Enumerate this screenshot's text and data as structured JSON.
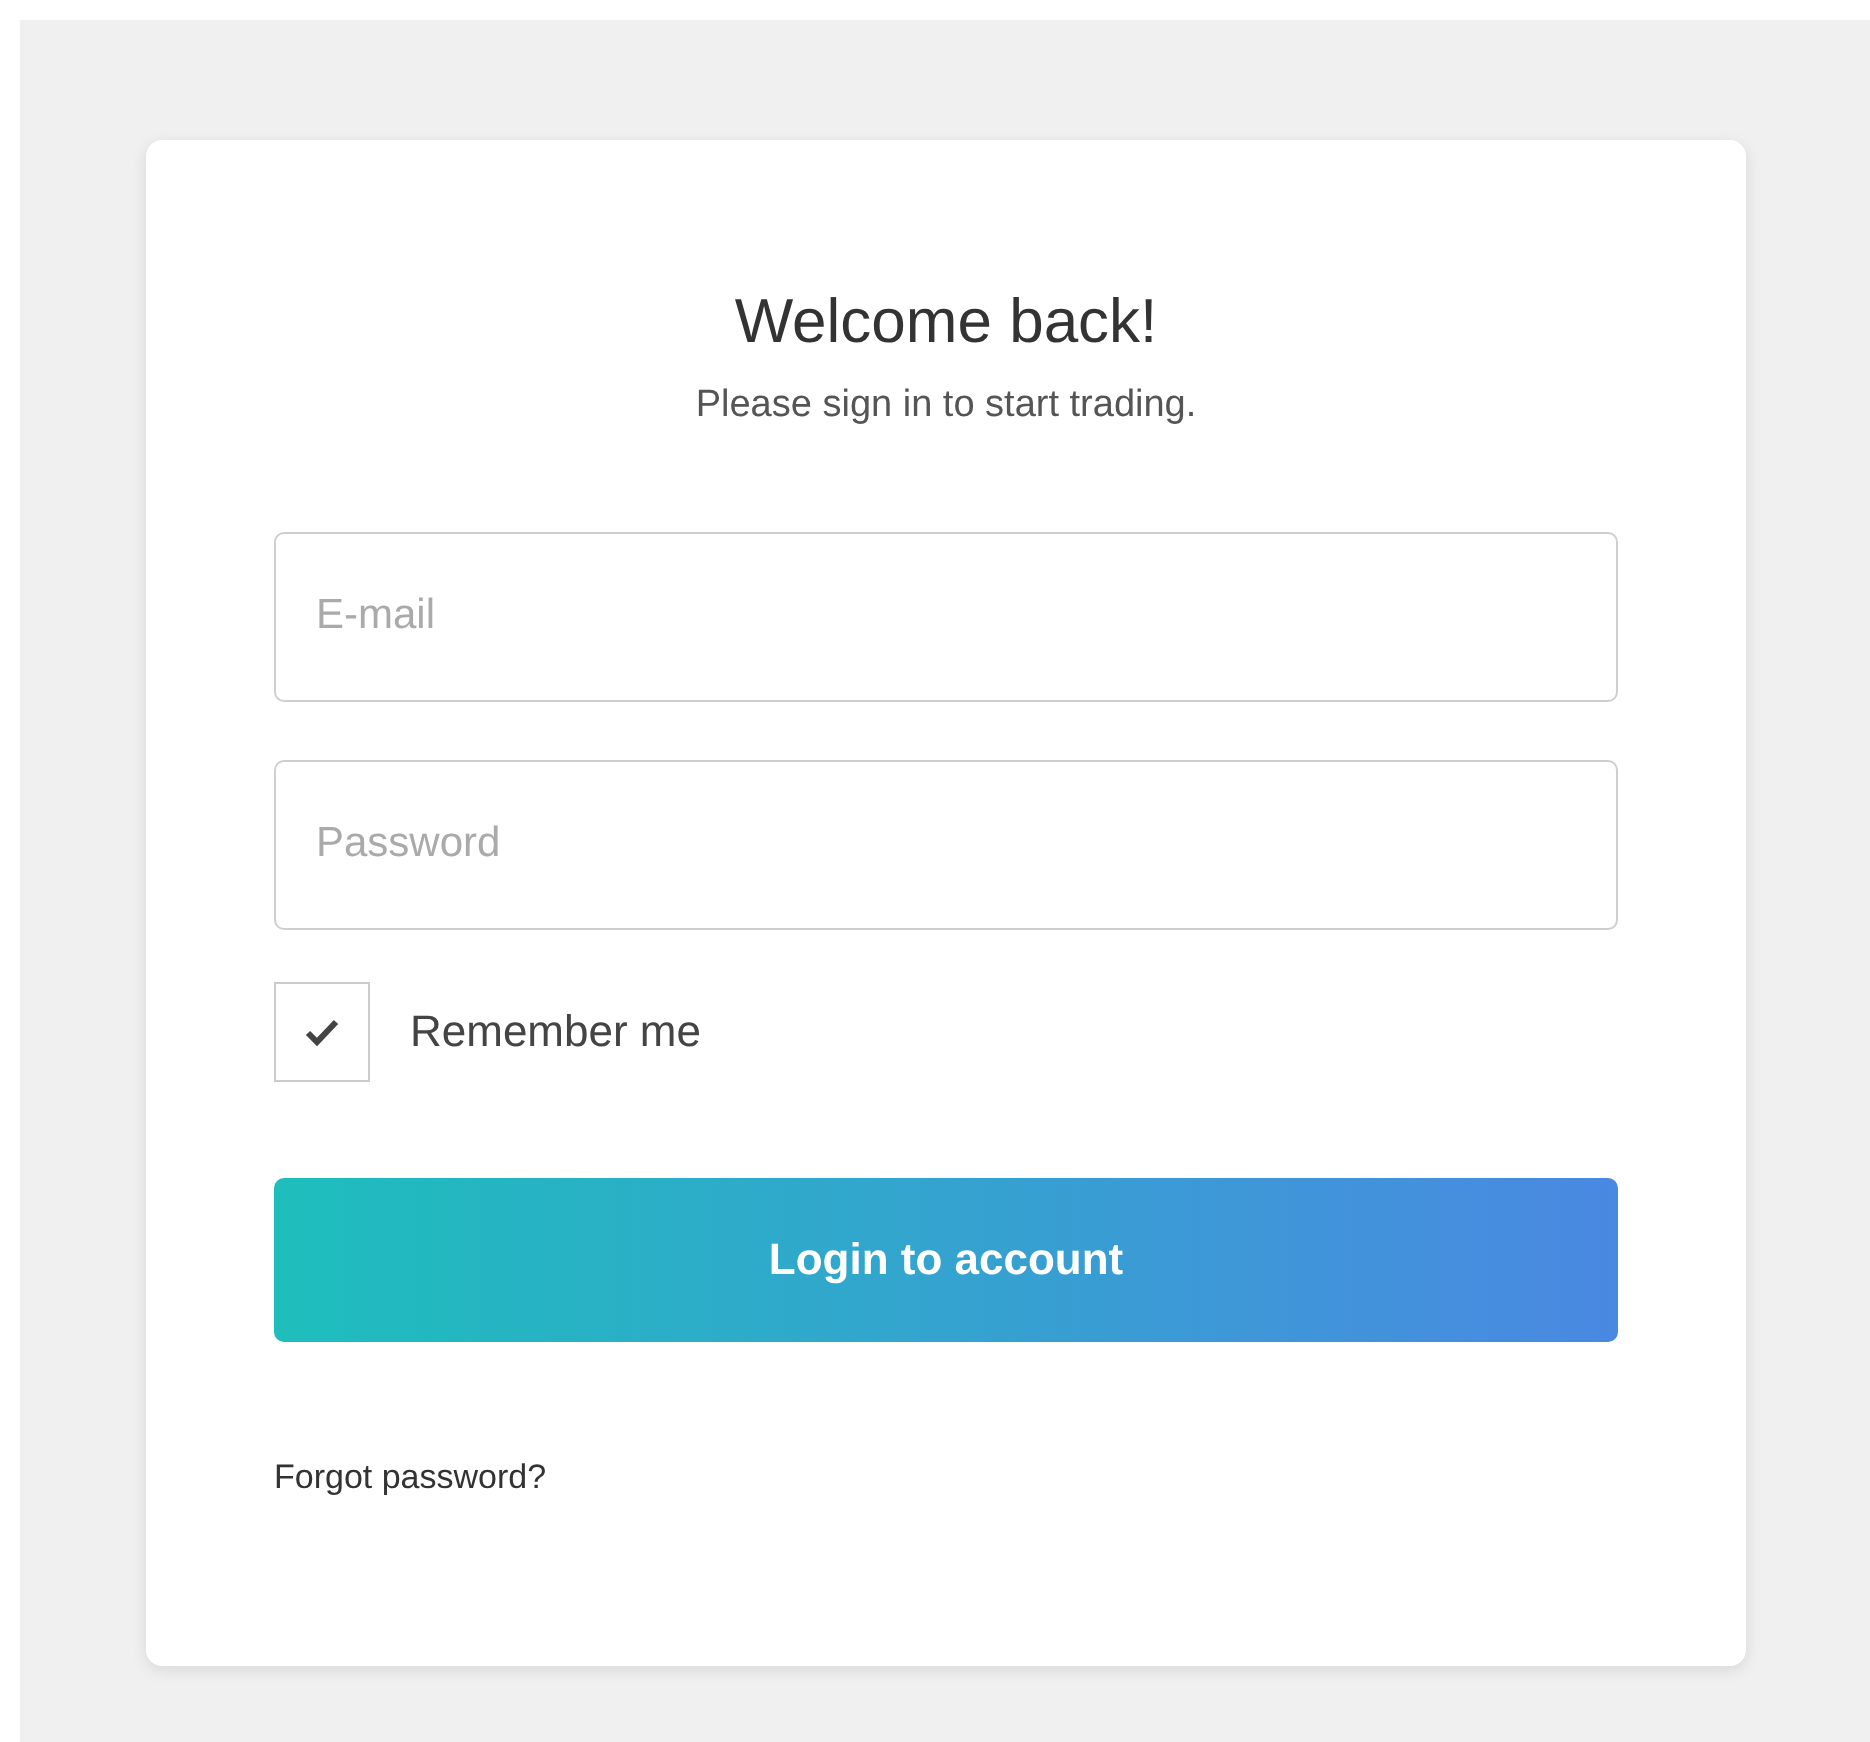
{
  "title": "Welcome back!",
  "subtitle": "Please sign in to start trading.",
  "fields": [
    {
      "placeholder": "E-mail"
    },
    {
      "placeholder": "Password"
    }
  ],
  "remember": {
    "label": "Remember me",
    "checked": true
  },
  "button": "Login to account",
  "forgot_link": "Forgot password?"
}
